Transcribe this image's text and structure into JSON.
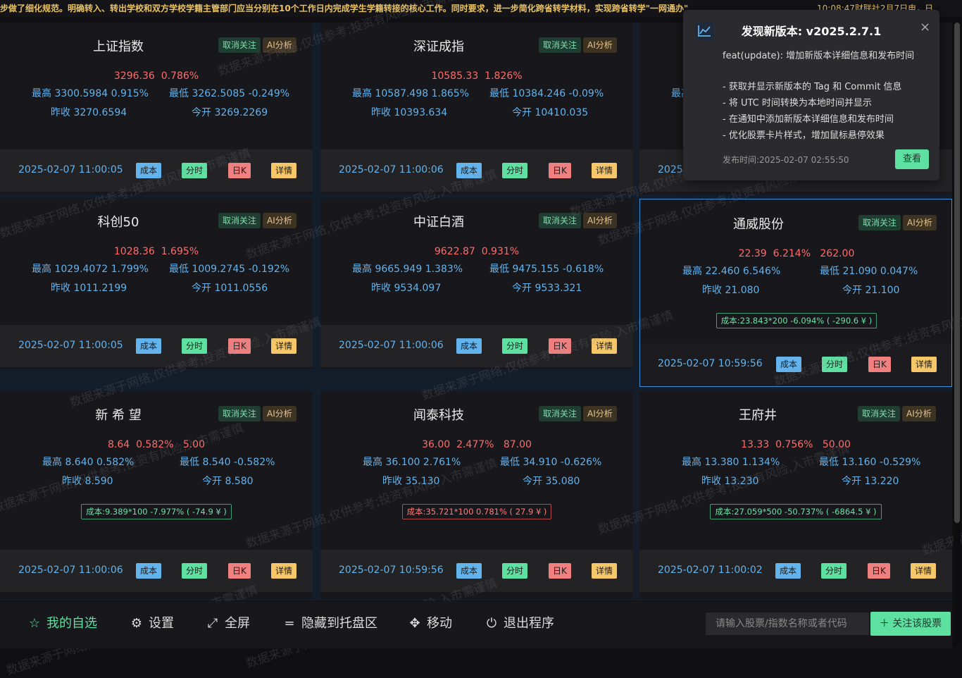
{
  "ticker": {
    "text": "步做了细化规范。明确转入、转出学校和双方学校学籍主管部门应当分别在10个工作日内完成学生学籍转接的核心工作。同时要求，进一步简化跨省转学材料，实现跨省转学\"一网通办\"",
    "right_text": "10:08:47财联社2月7日电，日"
  },
  "watermark": "数据来源于网络,仅供参考;投资有风险,入市需谨慎",
  "common": {
    "unfollow": "取消关注",
    "ai": "AI分析",
    "cost": "成本",
    "fenshi": "分时",
    "rik": "日K",
    "detail": "详情"
  },
  "cards": [
    {
      "name": "上证指数",
      "price": "3296.36",
      "pct": "0.786%",
      "vol": "",
      "high": "最高 3300.5984 0.915%",
      "low": "最低 3262.5085 -0.249%",
      "prev": "昨收 3270.6594",
      "open": "今开 3269.2269",
      "cost": "",
      "time": "2025-02-07 11:00:05"
    },
    {
      "name": "深证成指",
      "price": "10585.33",
      "pct": "1.826%",
      "vol": "",
      "high": "最高 10587.498 1.865%",
      "low": "最低 10384.246 -0.09%",
      "prev": "昨收 10393.634",
      "open": "今开 10410.035",
      "cost": "",
      "time": "2025-02-07 11:00:06"
    },
    {
      "name": "",
      "price": "",
      "pct": "",
      "vol": "",
      "high": "最高",
      "low": "",
      "prev": "",
      "open": "",
      "cost": "",
      "time": "2025-"
    },
    {
      "name": "科创50",
      "price": "1028.36",
      "pct": "1.695%",
      "vol": "",
      "high": "最高 1029.4072 1.799%",
      "low": "最低 1009.2745 -0.192%",
      "prev": "昨收 1011.2199",
      "open": "今开 1011.0556",
      "cost": "",
      "time": "2025-02-07 11:00:05"
    },
    {
      "name": "中证白酒",
      "price": "9622.87",
      "pct": "0.931%",
      "vol": "",
      "high": "最高 9665.949 1.383%",
      "low": "最低 9475.155 -0.618%",
      "prev": "昨收 9534.097",
      "open": "今开 9533.321",
      "cost": "",
      "time": "2025-02-07 11:00:06"
    },
    {
      "name": "通威股份",
      "price": "22.39",
      "pct": "6.214%",
      "vol": "262.00",
      "high": "最高 22.460 6.546%",
      "low": "最低 21.090 0.047%",
      "prev": "昨收 21.080",
      "open": "今开 21.100",
      "cost": "成本:23.843*200 -6.094% ( -290.6 ¥ )",
      "time": "2025-02-07 10:59:56"
    },
    {
      "name": "新 希 望",
      "price": "8.64",
      "pct": "0.582%",
      "vol": "5.00",
      "high": "最高 8.640 0.582%",
      "low": "最低 8.540 -0.582%",
      "prev": "昨收 8.590",
      "open": "今开 8.580",
      "cost": "成本:9.389*100 -7.977% ( -74.9 ¥ )",
      "time": "2025-02-07 11:00:06"
    },
    {
      "name": "闻泰科技",
      "price": "36.00",
      "pct": "2.477%",
      "vol": "87.00",
      "high": "最高 36.100 2.761%",
      "low": "最低 34.910 -0.626%",
      "prev": "昨收 35.130",
      "open": "今开 35.080",
      "cost": "成本:35.721*100 0.781% ( 27.9 ¥ )",
      "time": "2025-02-07 10:59:56"
    },
    {
      "name": "王府井",
      "price": "13.33",
      "pct": "0.756%",
      "vol": "50.00",
      "high": "最高 13.380 1.134%",
      "low": "最低 13.160 -0.529%",
      "prev": "昨收 13.230",
      "open": "今开 13.220",
      "cost": "成本:27.059*500 -50.737% ( -6864.5 ¥ )",
      "time": "2025-02-07 11:00:02"
    }
  ],
  "bottom_nav": [
    {
      "label": "我的自选",
      "icon": "star-icon",
      "glyph": "☆"
    },
    {
      "label": "设置",
      "icon": "gear-icon",
      "glyph": "⚙"
    },
    {
      "label": "全屏",
      "icon": "fullscreen-icon",
      "glyph": "⤢"
    },
    {
      "label": "隐藏到托盘区",
      "icon": "menu-icon",
      "glyph": "="
    },
    {
      "label": "移动",
      "icon": "move-icon",
      "glyph": "✥"
    },
    {
      "label": "退出程序",
      "icon": "power-icon",
      "glyph": "⏻"
    }
  ],
  "search": {
    "placeholder": "请输入股票/指数名称或者代码"
  },
  "add_button": "＋ 关注该股票",
  "notification": {
    "title": "发现新版本: v2025.2.7.1",
    "lines": [
      "feat(update): 增加新版本详细信息和发布时间",
      "- 获取并显示新版本的 Tag 和 Commit 信息",
      "- 将 UTC 时间转换为本地时间并显示",
      "- 在通知中添加新版本详细信息和发布时间",
      "- 优化股票卡片样式，增加鼠标悬停效果"
    ],
    "time": "发布时间:2025-02-07 02:55:50",
    "view": "查看",
    "close": "×"
  },
  "colors": {
    "accent": "#5ee0a0",
    "up": "#ff6b6b",
    "info": "#63b3ed",
    "warn": "#f6c768",
    "bg": "#101014"
  }
}
